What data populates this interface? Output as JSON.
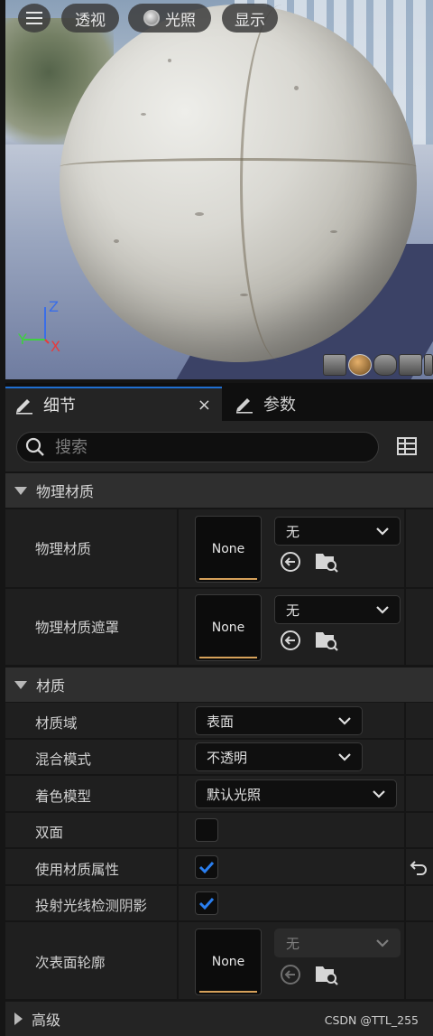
{
  "viewport": {
    "menu_icon": "hamburger-menu-icon",
    "perspective_label": "透视",
    "lighting_label": "光照",
    "show_label": "显示",
    "axis": {
      "z": "Z",
      "y": "Y",
      "x": "X",
      "z_color": "#3a6ee8",
      "y_color": "#3fd13f",
      "x_color": "#e83a3a"
    }
  },
  "tabs": [
    {
      "label": "细节",
      "icon": "pencil-icon",
      "active": true
    },
    {
      "label": "参数",
      "icon": "pencil-icon",
      "active": false
    }
  ],
  "tab_close": "×",
  "search": {
    "placeholder": "搜索",
    "value": ""
  },
  "sections": {
    "physical": {
      "title": "物理材质",
      "rows": [
        {
          "label": "物理材质",
          "thumb": "None",
          "value": "无"
        },
        {
          "label": "物理材质遮罩",
          "thumb": "None",
          "value": "无"
        }
      ]
    },
    "material": {
      "title": "材质",
      "rows": {
        "domain": {
          "label": "材质域",
          "value": "表面"
        },
        "blend": {
          "label": "混合模式",
          "value": "不透明"
        },
        "shading": {
          "label": "着色模型",
          "value": "默认光照"
        },
        "two_sided": {
          "label": "双面",
          "checked": false
        },
        "use_attrs": {
          "label": "使用材质属性",
          "checked": true
        },
        "ray_shadow": {
          "label": "投射光线检测阴影",
          "checked": true
        },
        "subsurface": {
          "label": "次表面轮廓",
          "thumb": "None",
          "value": "无"
        }
      }
    },
    "advanced": {
      "title": "高级"
    }
  },
  "watermark": "CSDN @TTL_255",
  "colors": {
    "accent": "#1f6fd1",
    "check": "#2a7ff0",
    "thumb_bar": "#d6a15a"
  }
}
